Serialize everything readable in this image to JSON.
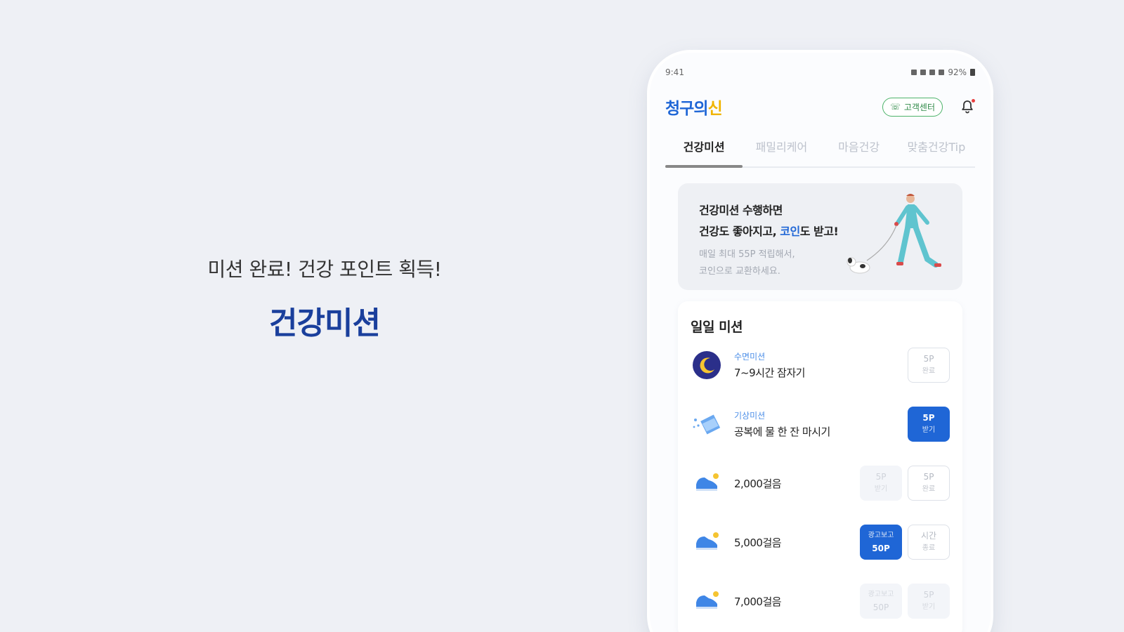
{
  "promo": {
    "subtitle": "미션 완료! 건강 포인트 획득!",
    "title": "건강미션"
  },
  "status_bar": {
    "time": "9:41",
    "battery": "92%"
  },
  "app_bar": {
    "logo_main": "청구의",
    "logo_accent": "신",
    "customer_center": "고객센터"
  },
  "tabs": [
    {
      "label": "건강미션",
      "active": true
    },
    {
      "label": "패밀리케어",
      "active": false
    },
    {
      "label": "마음건강",
      "active": false
    },
    {
      "label": "맞춤건강Tip",
      "active": false
    }
  ],
  "banner": {
    "line1": "건강미션 수행하면",
    "line2_prefix": "건강도 좋아지고, ",
    "line2_coin": "코인",
    "line2_suffix": "도 받고!",
    "desc1": "매일 최대 55P 적립해서,",
    "desc2": "코인으로 교환하세요."
  },
  "daily": {
    "title": "일일 미션",
    "missions": [
      {
        "category": "수면미션",
        "name": "7~9시간 잠자기",
        "icon": "moon-icon",
        "buttons": [
          {
            "top": "5P",
            "bottom": "완료",
            "style": "outline"
          }
        ]
      },
      {
        "category": "기상미션",
        "name": "공복에 물 한 잔 마시기",
        "icon": "water-icon",
        "buttons": [
          {
            "top": "5P",
            "bottom": "받기",
            "style": "filled"
          }
        ]
      },
      {
        "category": "",
        "name": "2,000걸음",
        "icon": "shoe-icon",
        "buttons": [
          {
            "top": "5P",
            "bottom": "받기",
            "style": "ghost"
          },
          {
            "top": "5P",
            "bottom": "완료",
            "style": "outline"
          }
        ]
      },
      {
        "category": "",
        "name": "5,000걸음",
        "icon": "shoe-icon",
        "buttons": [
          {
            "top": "광고보고",
            "bottom": "50P",
            "style": "filled"
          },
          {
            "top": "시간",
            "bottom": "종료",
            "style": "outline"
          }
        ]
      },
      {
        "category": "",
        "name": "7,000걸음",
        "icon": "shoe-icon",
        "buttons": [
          {
            "top": "광고보고",
            "bottom": "50P",
            "style": "ghost"
          },
          {
            "top": "5P",
            "bottom": "받기",
            "style": "ghost"
          }
        ]
      }
    ]
  },
  "colors": {
    "background": "#eef0f5",
    "brand_blue": "#1f66d6",
    "promo_title": "#1a3f9c",
    "logo_accent": "#f0b400",
    "cs_green": "#4db36a"
  }
}
